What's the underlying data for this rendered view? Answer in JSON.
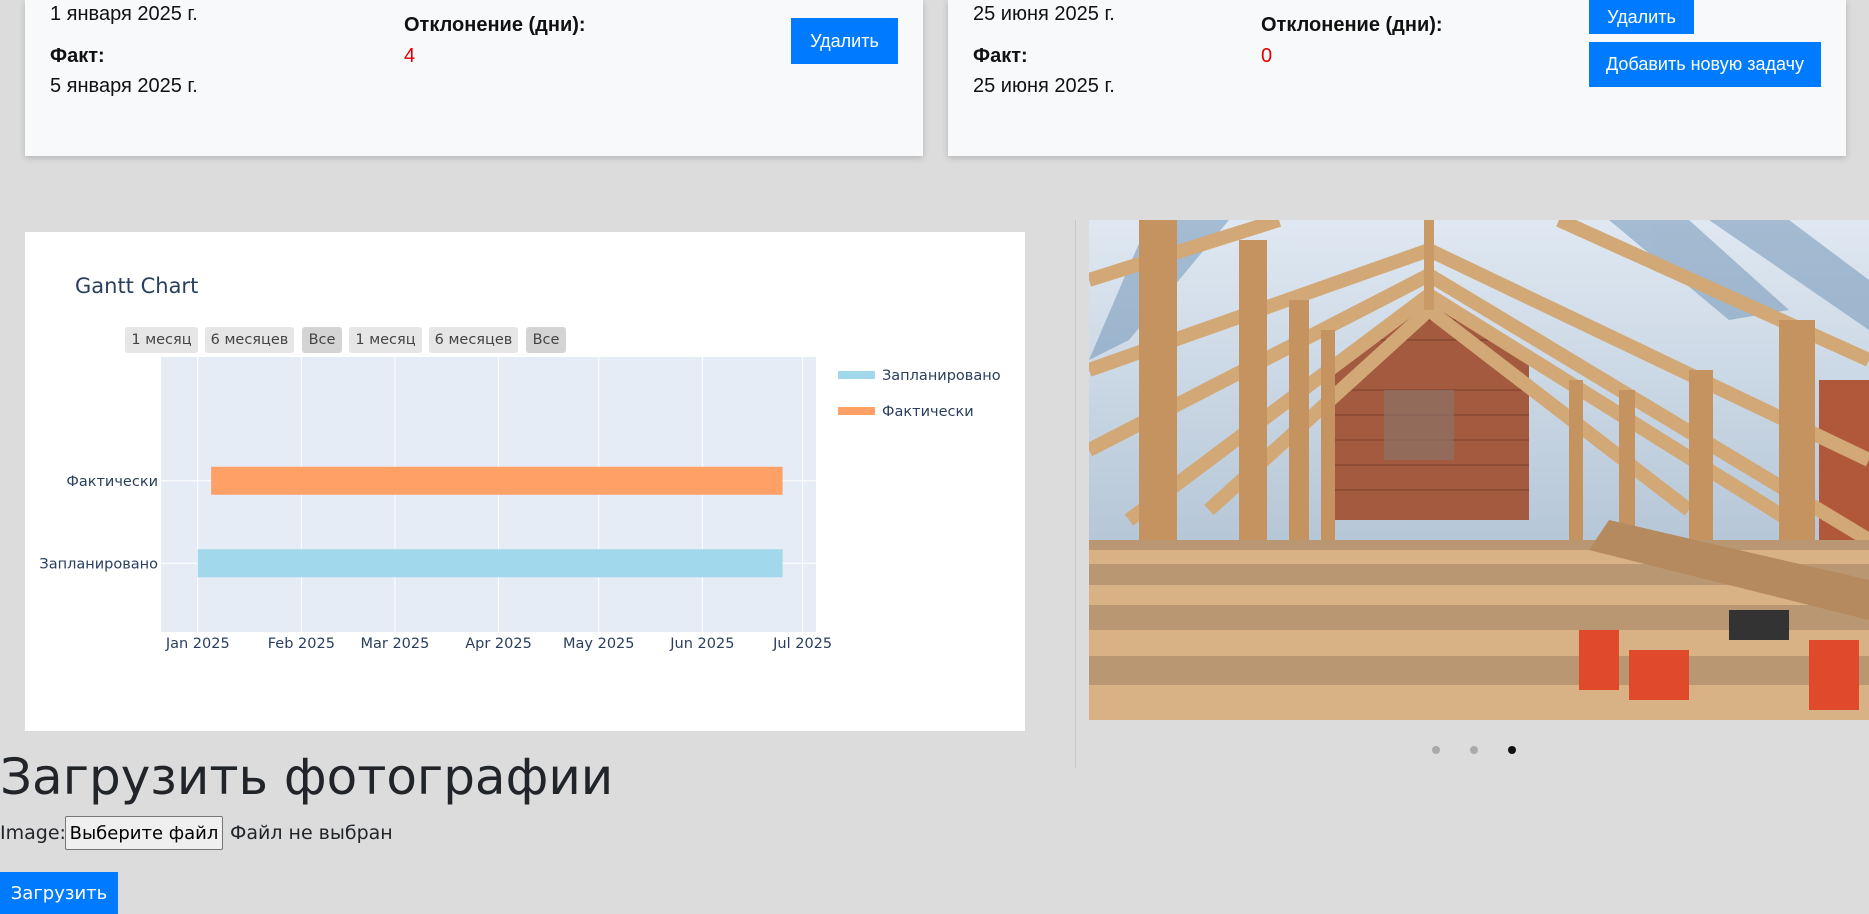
{
  "tasks": [
    {
      "planned_date": "1 января 2025 г.",
      "fact_label": "Факт:",
      "fact_date": "5 января 2025 г.",
      "deviation_label": "Отклонение (дни):",
      "deviation_value": "4",
      "delete_label": "Удалить"
    },
    {
      "planned_date": "25 июня 2025 г.",
      "fact_label": "Факт:",
      "fact_date": "25 июня 2025 г.",
      "deviation_label": "Отклонение (дни):",
      "deviation_value": "0",
      "delete_label": "Удалить",
      "add_task_label": "Добавить новую задачу"
    }
  ],
  "colors": {
    "primary": "#007bff",
    "deviation": "#e00000",
    "planned_bar": "#a1d8ec",
    "actual_bar": "#ffa066",
    "plot_bg": "#e5ecf6"
  },
  "range_selector": [
    "1 месяц",
    "6 месяцев",
    "Все",
    "1 месяц",
    "6 месяцев",
    "Все"
  ],
  "chart_data": {
    "type": "gantt",
    "title": "Gantt Chart",
    "categories": [
      "Запланировано",
      "Фактически"
    ],
    "series": [
      {
        "name": "Запланировано",
        "start": "2025-01-01",
        "end": "2025-06-25",
        "color": "#a1d8ec"
      },
      {
        "name": "Фактически",
        "start": "2025-01-05",
        "end": "2025-06-25",
        "color": "#ffa066"
      }
    ],
    "x_ticks": [
      "Jan 2025",
      "Feb 2025",
      "Mar 2025",
      "Apr 2025",
      "May 2025",
      "Jun 2025",
      "Jul 2025"
    ],
    "x_tick_dates": [
      "2025-01-01",
      "2025-02-01",
      "2025-03-01",
      "2025-04-01",
      "2025-05-01",
      "2025-06-01",
      "2025-07-01"
    ],
    "xlim": [
      "2024-12-21",
      "2025-07-05"
    ],
    "grid": true,
    "legend": "top-right"
  },
  "carousel": {
    "photo_icon": "attic-roof-rafters-photo",
    "dots": [
      false,
      false,
      true
    ],
    "dot_active_color": "#111111",
    "dot_inactive_color": "#aaaaaa"
  },
  "upload": {
    "heading": "Загрузить фотографии",
    "image_label": "Image:",
    "choose_file": "Выберите файл",
    "no_file": "Файл не выбран",
    "submit": "Загрузить"
  }
}
